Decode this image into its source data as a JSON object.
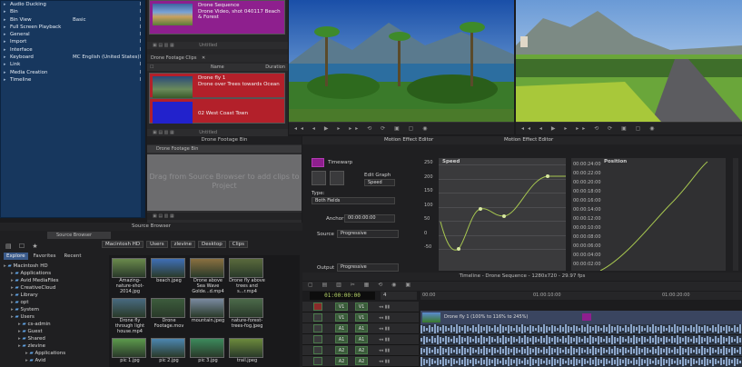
{
  "settings": {
    "items": [
      {
        "label": "Audio Ducking",
        "value": "",
        "check": "L"
      },
      {
        "label": "Bin",
        "value": "",
        "check": "L"
      },
      {
        "label": "Bin View",
        "value": "Basic",
        "check": "L"
      },
      {
        "label": "Full Screen Playback",
        "value": "",
        "check": "L"
      },
      {
        "label": "General",
        "value": "",
        "check": "L"
      },
      {
        "label": "Import",
        "value": "",
        "check": "L"
      },
      {
        "label": "Interface",
        "value": "",
        "check": "L"
      },
      {
        "label": "Keyboard",
        "value": "MC English (United States)",
        "check": "L"
      },
      {
        "label": "Link",
        "value": "",
        "check": "L"
      },
      {
        "label": "Media Creation",
        "value": "",
        "check": "L"
      },
      {
        "label": "Timeline",
        "value": "",
        "check": "L"
      }
    ]
  },
  "bin": {
    "sequence_clip": {
      "name": "Drone Sequence",
      "desc": "Drone Video, shot 040117 Beach & Forest"
    },
    "untitled": "Untitled",
    "tab": "Drone Footage Clips",
    "col_name": "Name",
    "col_duration": "Duration",
    "clips": [
      {
        "name": "Drone fly 1",
        "desc": "Drone over Trees towards Ocean"
      },
      {
        "name": "02 West Coast Town",
        "desc": ""
      }
    ],
    "untitled2": "Untitled"
  },
  "footage_bin": {
    "title": "Drone Footage Bin",
    "tab": "Drone Footage Bin",
    "drop_text": "Drag from Source Browser to add clips to Project"
  },
  "motion": {
    "title_left": "Motion Effect Editor",
    "title_right": "Motion Effect Editor",
    "timewarp": "Timewarp",
    "edit_graph": "Edit Graph",
    "edit_graph_value": "Speed",
    "type_label": "Type:",
    "type_value": "Both Fields",
    "anchor_label": "Anchor",
    "anchor_value": "00:00:00:00",
    "source_label": "Source",
    "source_value": "Progressive",
    "output_label": "Output",
    "output_value": "Progressive",
    "speed_label": "Speed",
    "position_label": "Position",
    "speed_ticks": [
      "250",
      "200",
      "150",
      "100",
      "50",
      "0",
      "-50"
    ],
    "position_ticks": [
      "00:00:24:00",
      "00:00:22:00",
      "00:00:20:00",
      "00:00:18:00",
      "00:00:16:00",
      "00:00:14:00",
      "00:00:12:00",
      "00:00:10:00",
      "00:00:08:00",
      "00:00:06:00",
      "00:00:04:00",
      "00:00:02:00"
    ]
  },
  "browser": {
    "title": "Source Browser",
    "tab": "Source Browser",
    "path": [
      "Macintosh HD",
      "Users",
      "zlevine",
      "Desktop",
      "Clips"
    ],
    "tabs": [
      "Explore",
      "Favorites",
      "Recent"
    ],
    "tree": [
      {
        "label": "Macintosh HD",
        "indent": 0
      },
      {
        "label": "Applications",
        "indent": 1
      },
      {
        "label": "Avid MediaFiles",
        "indent": 1
      },
      {
        "label": "CreativeCloud",
        "indent": 1
      },
      {
        "label": "Library",
        "indent": 1
      },
      {
        "label": "opt",
        "indent": 1
      },
      {
        "label": "System",
        "indent": 1
      },
      {
        "label": "Users",
        "indent": 1
      },
      {
        "label": "cs-admin",
        "indent": 2
      },
      {
        "label": "Guest",
        "indent": 2
      },
      {
        "label": "Shared",
        "indent": 2
      },
      {
        "label": "zlevine",
        "indent": 2
      },
      {
        "label": "Applications",
        "indent": 3
      },
      {
        "label": "Avid",
        "indent": 3
      }
    ],
    "thumbs": [
      {
        "cap": "Amazing-nature-shot-2014.jpg",
        "color": "#6a8a4c"
      },
      {
        "cap": "beach.jpeg",
        "color": "#3f6fb6"
      },
      {
        "cap": "Drone above Sea Wave Golde...d.mp4",
        "color": "#8a7040"
      },
      {
        "cap": "Drone fly above trees and s...r.mp4",
        "color": "#5a6a3c"
      },
      {
        "cap": "Drone fly through light house.mp4",
        "color": "#486a80"
      },
      {
        "cap": "Drone Footage.mov",
        "color": "#3c5c3c"
      },
      {
        "cap": "mountain.jpeg",
        "color": "#7a8aa0"
      },
      {
        "cap": "nature-forest-trees-fog.jpeg",
        "color": "#4c6a4a"
      },
      {
        "cap": "pic 1.jpg",
        "color": "#5c9a4c"
      },
      {
        "cap": "pic 2.jpg",
        "color": "#4c86b0"
      },
      {
        "cap": "pic 3.jpg",
        "color": "#3c8a5c"
      },
      {
        "cap": "trail.jpeg",
        "color": "#6c8a3c"
      }
    ]
  },
  "timeline": {
    "title": "Timeline - Drone Sequence - 1280x720 - 29.97 fps",
    "timecode": "01:00:00:00",
    "counter": "4",
    "ruler": [
      "00:00",
      "01:00:10:00",
      "01:00:20:00"
    ],
    "tracks": [
      "V1",
      "V1",
      "A1",
      "A1",
      "A2",
      "A2"
    ],
    "clip_label": "Drone fly 1 (100% to 116% to 245%)"
  },
  "colors": {
    "accent_magenta": "#8e1f8e",
    "clip_red": "#b3202a",
    "settings_blue": "#17375e"
  }
}
